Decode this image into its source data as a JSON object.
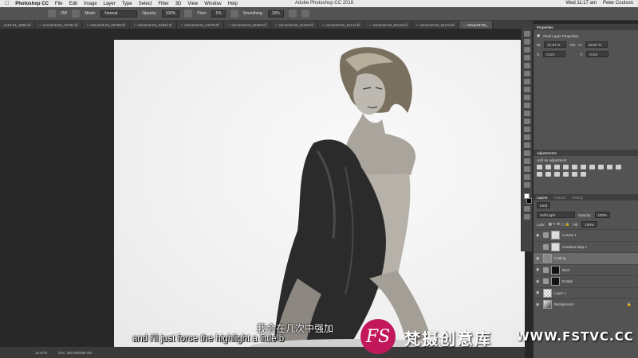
{
  "menubar": {
    "items": [
      "Photoshop CC",
      "File",
      "Edit",
      "Image",
      "Layer",
      "Type",
      "Select",
      "Filter",
      "3D",
      "View",
      "Window",
      "Help"
    ],
    "window_title": "Adobe Photoshop CC 2018",
    "clock": "Wed 11:17 am",
    "user": "Peter Coulson"
  },
  "options_bar": {
    "mode_label": "Mode:",
    "mode_value": "Normal",
    "opacity_label": "Opacity:",
    "opacity_value": "100%",
    "flow_label": "Flow:",
    "flow_value": "1%",
    "smoothing_label": "Smoothing:",
    "smoothing_value": "10%",
    "brush_size": "250"
  },
  "doc_tabs": [
    "ss18-01_5082.tif",
    "esnue18-03_63784.tif",
    "esnue18-03_63788.tif",
    "esnue18-03_62811.tif",
    "esnue18-03_61078.tif",
    "esnue18-03_61083.tif",
    "esnue18-03_61108.tif",
    "esnue18-03_61144.tif",
    "esnue18-03_60126.tif",
    "esnue18-03_61176.tif",
    "esnue18-03_"
  ],
  "status": {
    "zoom": "16.67%",
    "doc_size": "Doc: 282.0M/288.4M"
  },
  "properties_panel": {
    "title": "Properties",
    "subtitle": "Pixel Layer Properties",
    "w_label": "W:",
    "w_value": "27.57 in",
    "h_label": "H:",
    "h_value": "20.87 in",
    "go_label": "GO",
    "x_label": "X:",
    "x_value": "0 cm",
    "y_label": "Y:",
    "y_value": "0 cm"
  },
  "adjustments_panel": {
    "title": "Adjustments",
    "subtitle": "Add an adjustment"
  },
  "layers_panel": {
    "tabs": [
      "Layers",
      "Actions",
      "History"
    ],
    "filter_kind": "Kind",
    "blend_mode": "Soft Light",
    "opacity_label": "Opacity:",
    "opacity_value": "100%",
    "lock_label": "Lock:",
    "fill_label": "Fill:",
    "fill_value": "100%",
    "layers": [
      {
        "name": "Curves 1",
        "thumb": "white",
        "adj": true,
        "visible": true
      },
      {
        "name": "Gradient Map 1",
        "thumb": "white",
        "adj": true,
        "visible": false
      },
      {
        "name": "Cutting",
        "thumb": "gray",
        "adj": false,
        "visible": true,
        "selected": true
      },
      {
        "name": "Burn",
        "thumb": "dark",
        "adj": true,
        "visible": true
      },
      {
        "name": "Dodge",
        "thumb": "dark",
        "adj": true,
        "visible": true
      },
      {
        "name": "Layer 1",
        "thumb": "checker",
        "adj": false,
        "visible": true
      },
      {
        "name": "Background",
        "thumb": "photo",
        "adj": false,
        "visible": true,
        "locked": true
      }
    ]
  },
  "subtitles": {
    "cn": "我会在几次中强加",
    "en": "and i'll just force the highlight a little b"
  },
  "watermark": {
    "logo": "FS",
    "name_cn": "梵摄创意库",
    "url": "WWW.FSTVC.CC"
  }
}
